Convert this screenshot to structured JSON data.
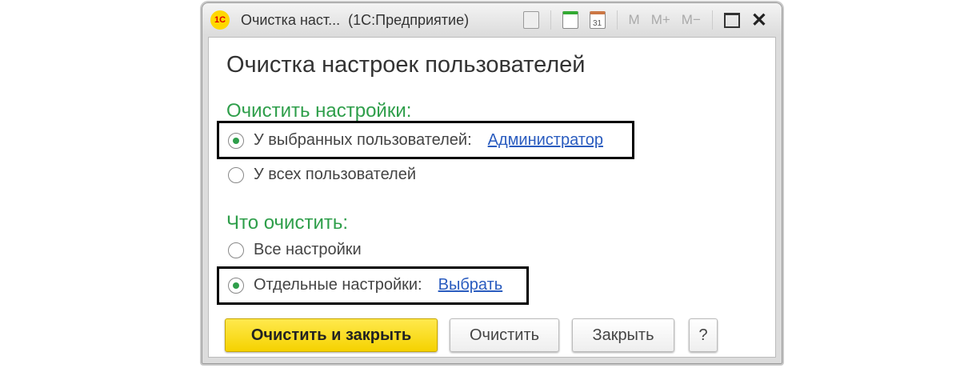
{
  "window": {
    "title": "Очистка наст...  (1С:Предприятие)",
    "logo": "1С",
    "toolbar": {
      "m": "M",
      "m_plus": "M+",
      "m_minus": "M−",
      "calendar_day": "31"
    }
  },
  "form": {
    "heading": "Очистка настроек пользователей",
    "clear_settings_label": "Очистить настройки:",
    "users_options": [
      {
        "label": "У выбранных пользователей:",
        "link": "Администратор",
        "selected": true
      },
      {
        "label": "У всех пользователей",
        "selected": false
      }
    ],
    "what_label": "Что очистить:",
    "what_options": [
      {
        "label": "Все настройки",
        "selected": false
      },
      {
        "label": "Отдельные настройки:",
        "link": "Выбрать",
        "selected": true
      }
    ]
  },
  "buttons": {
    "clear_close": "Очистить и закрыть",
    "clear": "Очистить",
    "close": "Закрыть",
    "help": "?"
  },
  "colors": {
    "accent_green": "#2e9e4a",
    "link": "#2a5cbf",
    "primary_button": "#f5d200"
  }
}
